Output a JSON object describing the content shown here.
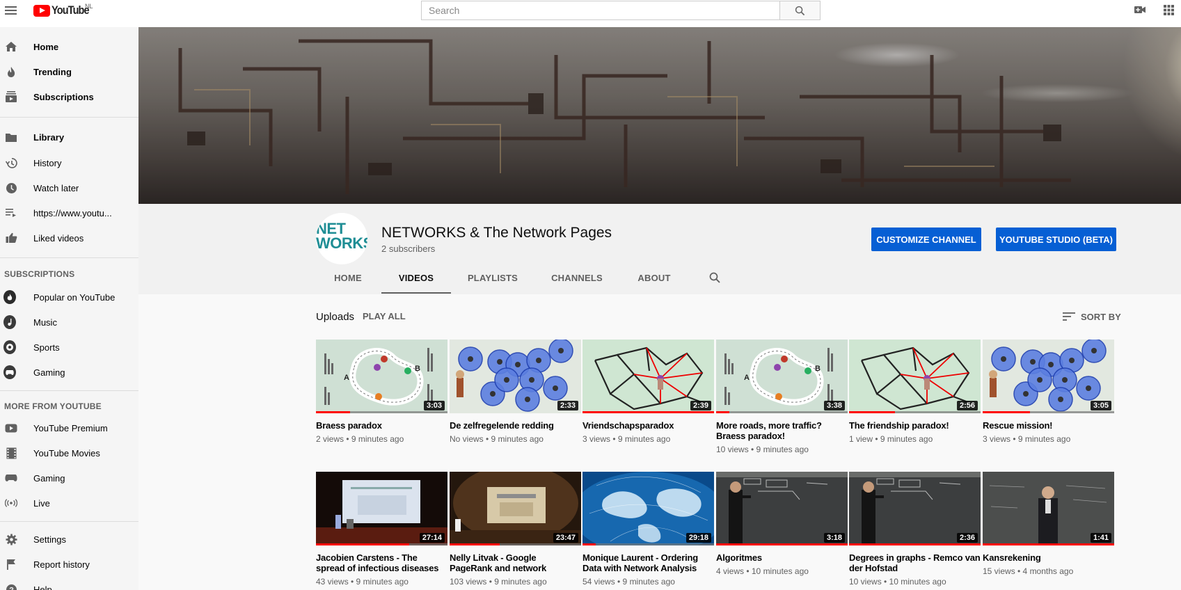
{
  "topbar": {
    "logo_text": "YouTube",
    "country": "NL",
    "search_placeholder": "Search",
    "icons": [
      "menu-icon",
      "search-icon",
      "create-video-icon",
      "apps-grid-icon"
    ]
  },
  "sidebar": {
    "main": [
      {
        "label": "Home",
        "icon": "home-icon"
      },
      {
        "label": "Trending",
        "icon": "flame-icon"
      },
      {
        "label": "Subscriptions",
        "icon": "subscriptions-icon"
      }
    ],
    "library": [
      {
        "label": "Library",
        "icon": "folder-icon"
      },
      {
        "label": "History",
        "icon": "history-icon"
      },
      {
        "label": "Watch later",
        "icon": "clock-icon"
      },
      {
        "label": "https://www.youtu...",
        "icon": "playlist-icon"
      },
      {
        "label": "Liked videos",
        "icon": "thumb-up-icon"
      }
    ],
    "subscriptions_heading": "SUBSCRIPTIONS",
    "subscriptions": [
      {
        "label": "Popular on YouTube"
      },
      {
        "label": "Music"
      },
      {
        "label": "Sports"
      },
      {
        "label": "Gaming"
      }
    ],
    "more_heading": "MORE FROM YOUTUBE",
    "more": [
      {
        "label": "YouTube Premium",
        "icon": "youtube-icon"
      },
      {
        "label": "YouTube Movies",
        "icon": "film-icon"
      },
      {
        "label": "Gaming",
        "icon": "gamepad-icon"
      },
      {
        "label": "Live",
        "icon": "live-icon"
      }
    ],
    "bottom": [
      {
        "label": "Settings",
        "icon": "gear-icon"
      },
      {
        "label": "Report history",
        "icon": "flag-icon"
      },
      {
        "label": "Help",
        "icon": "help-icon"
      }
    ]
  },
  "channel": {
    "avatar_text_line1": "NET",
    "avatar_text_line2": "WORKS",
    "name": "NETWORKS & The Network Pages",
    "subscribers": "2 subscribers",
    "customize_button": "CUSTOMIZE CHANNEL",
    "studio_button": "YOUTUBE STUDIO (BETA)",
    "tabs": [
      "HOME",
      "VIDEOS",
      "PLAYLISTS",
      "CHANNELS",
      "ABOUT"
    ],
    "active_tab": "VIDEOS"
  },
  "uploads": {
    "label": "Uploads",
    "play_all": "PLAY ALL",
    "sort_by": "SORT BY"
  },
  "videos": [
    {
      "title": "Braess paradox",
      "meta": "2 views • 9 minutes ago",
      "duration": "3:03",
      "progress": 0.26
    },
    {
      "title": "De zelfregelende redding",
      "meta": "No views • 9 minutes ago",
      "duration": "2:33",
      "progress": 0.0
    },
    {
      "title": "Vriendschapsparadox",
      "meta": "3 views • 9 minutes ago",
      "duration": "2:39",
      "progress": 1.0
    },
    {
      "title": "More roads, more traffic? Braess paradox!",
      "meta": "10 views • 9 minutes ago",
      "duration": "3:38",
      "progress": 0.1
    },
    {
      "title": "The friendship paradox!",
      "meta": "1 view • 9 minutes ago",
      "duration": "2:56",
      "progress": 0.35
    },
    {
      "title": "Rescue mission!",
      "meta": "3 views • 9 minutes ago",
      "duration": "3:05",
      "progress": 0.36
    },
    {
      "title": "Jacobien Carstens - The spread of infectious diseases",
      "meta": "43 views • 9 minutes ago",
      "duration": "27:14",
      "progress": 0.71
    },
    {
      "title": "Nelly Litvak - Google PageRank and network",
      "meta": "103 views • 9 minutes ago",
      "duration": "23:47",
      "progress": 0.38
    },
    {
      "title": "Monique Laurent - Ordering Data with Network Analysis",
      "meta": "54 views • 9 minutes ago",
      "duration": "29:18",
      "progress": 0.1
    },
    {
      "title": "Algoritmes",
      "meta": "4 views • 10 minutes ago",
      "duration": "3:18",
      "progress": 1.0
    },
    {
      "title": "Degrees in graphs - Remco van der Hofstad",
      "meta": "10 views • 10 minutes ago",
      "duration": "2:36",
      "progress": 1.0
    },
    {
      "title": "Kansrekening",
      "meta": "15 views • 4 months ago",
      "duration": "1:41",
      "progress": 1.0
    }
  ]
}
